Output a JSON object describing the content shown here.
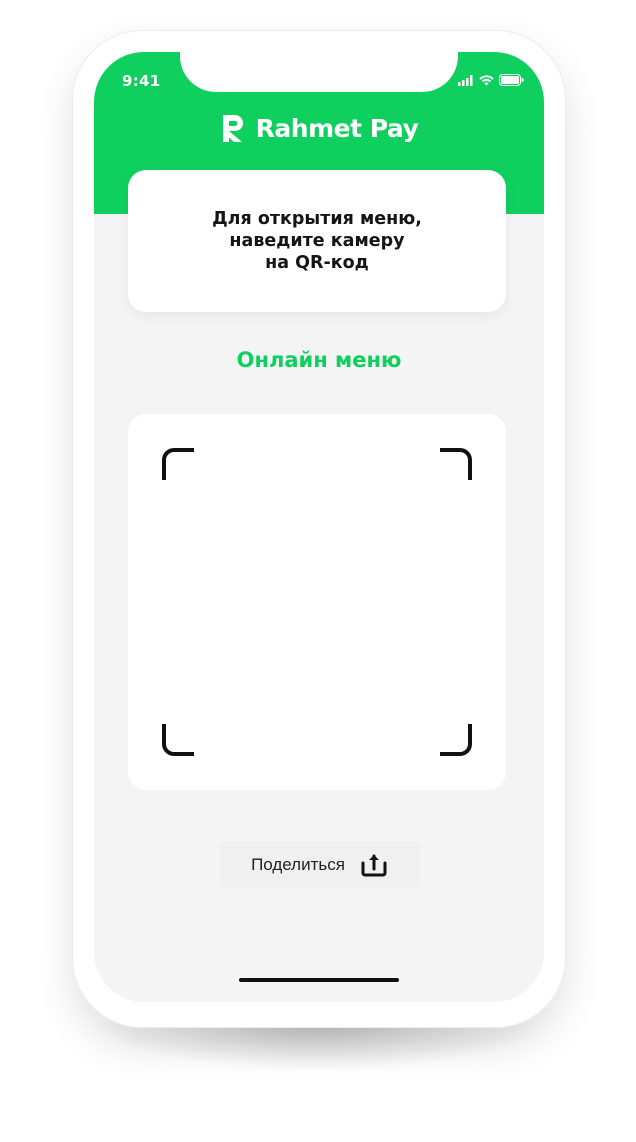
{
  "status_bar": {
    "time": "9:41",
    "icons": [
      "signal-icon",
      "wifi-icon",
      "battery-icon"
    ]
  },
  "header": {
    "logo_text": "Rahmet Pay",
    "background_color": "#0fd05f"
  },
  "info_card": {
    "text": "Для открытия меню,\nнаведите камеру\nна QR-код"
  },
  "section_title": "Онлайн меню",
  "scanner": {
    "frame": "qr-scan-frame"
  },
  "share": {
    "label": "Поделиться",
    "icon": "share-icon"
  },
  "colors": {
    "accent": "#0fd05f",
    "screen_background": "#f4f4f4",
    "card_background": "#ffffff"
  }
}
